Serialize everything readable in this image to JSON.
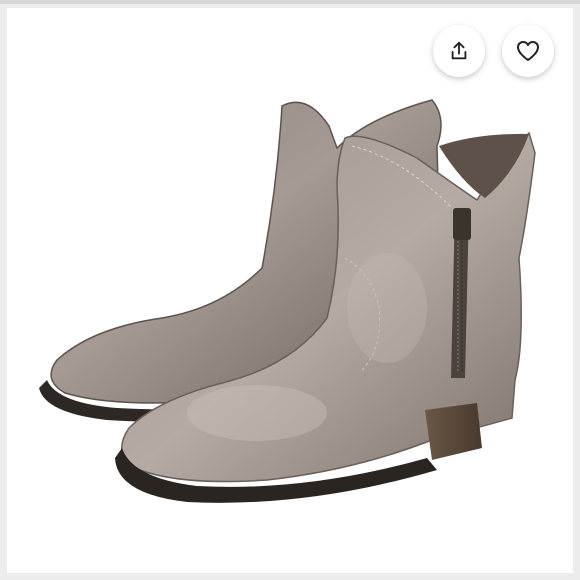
{
  "product_image": {
    "description_icon": "ankle-boot-photo"
  },
  "actions": {
    "share_icon": "share-upload-icon",
    "like_icon": "heart-outline-icon"
  },
  "colors": {
    "background": "#ececec",
    "button_bg": "#ffffff",
    "icon_stroke": "#222222"
  }
}
